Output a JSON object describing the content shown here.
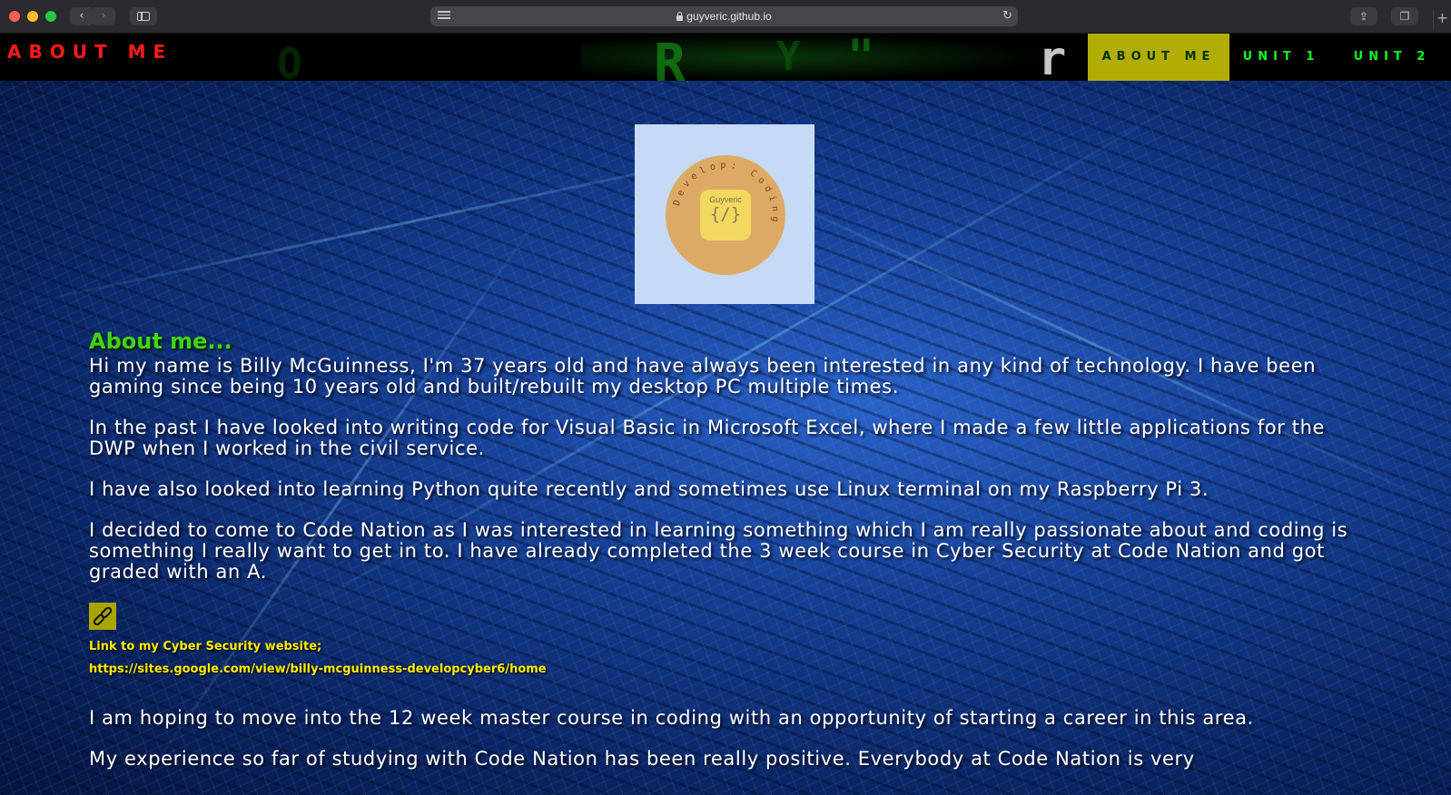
{
  "browser": {
    "url": "guyveric.github.io",
    "back_icon": "‹",
    "forward_icon": "›",
    "reload_icon": "↻",
    "share_icon": "⇪",
    "tabs_icon": "❐",
    "new_tab_icon": "+"
  },
  "site": {
    "brand": "ABOUT ME",
    "nav": {
      "about": "ABOUT ME",
      "unit1": "UNIT 1",
      "unit2": "UNIT 2"
    },
    "header_glyphs": [
      "O",
      "R",
      "Y",
      "\"",
      "r"
    ]
  },
  "logo": {
    "name": "Guyveric",
    "code": "{/}",
    "ring_text": "Develop: Coding"
  },
  "content": {
    "heading": "About me...",
    "paragraphs": [
      "Hi my name is Billy McGuinness, I'm 37 years old and have always been interested in any kind of technology. I have been gaming since being 10 years old and built/rebuilt my desktop PC multiple times.",
      "In the past I have looked into writing code for Visual Basic in Microsoft Excel, where I made a few little applications for the DWP when I worked in the civil service.",
      "I have also looked into learning Python quite recently and sometimes use Linux terminal on my Raspberry Pi 3.",
      "I decided to come to Code Nation as I was interested in learning something which I am really passionate about and coding is something I really want to get in to. I have already completed the 3 week course in Cyber Security at Code Nation and got graded with an A."
    ],
    "link_label": "Link to my Cyber Security website;",
    "link_url": "https://sites.google.com/view/billy-mcguinness-developcyber6/home",
    "after_paragraphs": [
      "I am hoping to move into the 12 week master course in coding with an opportunity of starting a career in this area.",
      "My experience so far of studying with Code Nation has been really positive. Everybody at Code Nation is very"
    ]
  },
  "colors": {
    "brand": "#ff1a1a",
    "nav_text": "#00ff22",
    "nav_active_bg": "#b2ad05",
    "heading": "#3fd614",
    "link": "#ffee00"
  }
}
